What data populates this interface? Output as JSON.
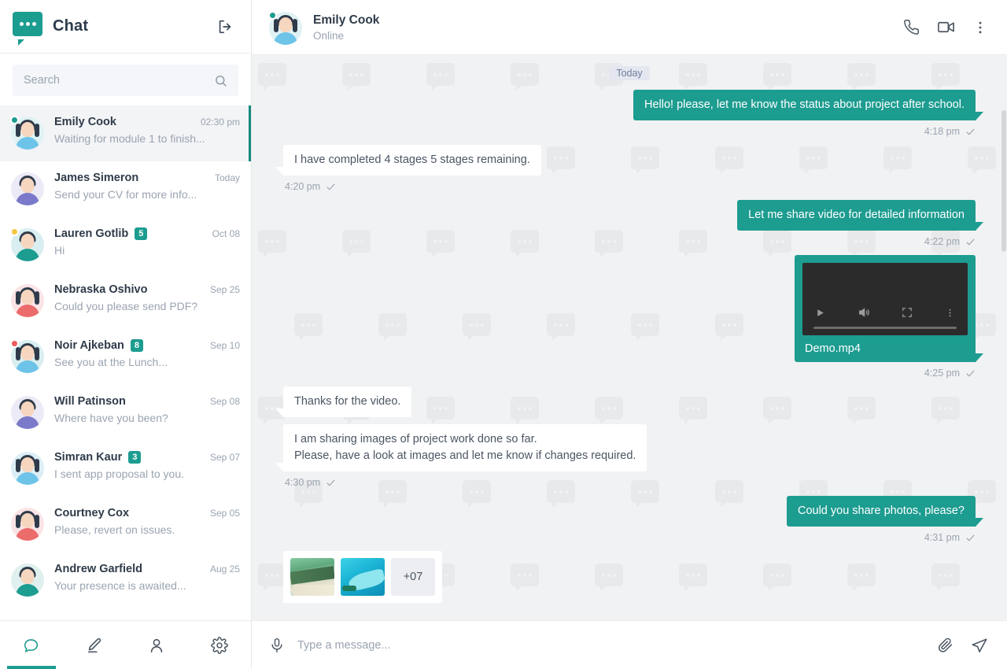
{
  "sidebar": {
    "app_title": "Chat",
    "logo_icon": "chat-bubble-logo",
    "logout_icon": "logout-icon",
    "search": {
      "placeholder": "Search",
      "value": "",
      "icon": "search-icon"
    },
    "contacts": [
      {
        "name": "Emily Cook",
        "preview": "Waiting for module 1 to finish...",
        "time": "02:30 pm",
        "badge": "",
        "status": "online",
        "active": true,
        "avatar": {
          "bg": "#e0f2f4",
          "skin": "#f6d6bf",
          "hair": "#2f3b4a",
          "shirt": "#6ec4e8",
          "dot": "#1d9c90",
          "long_hair": true
        }
      },
      {
        "name": "James Simeron",
        "preview": "Send your CV for more info...",
        "time": "Today",
        "badge": "",
        "status": "none",
        "active": false,
        "avatar": {
          "bg": "#eceaf6",
          "skin": "#f6d6bf",
          "hair": "#2f3b4a",
          "shirt": "#7b79c9",
          "dot": "",
          "long_hair": false
        }
      },
      {
        "name": "Lauren Gotlib",
        "preview": "Hi",
        "time": "Oct 08",
        "badge": "5",
        "status": "away",
        "active": false,
        "avatar": {
          "bg": "#d9eef0",
          "skin": "#f6d6bf",
          "hair": "#2f3b4a",
          "shirt": "#1d9c90",
          "dot": "#f5c544",
          "long_hair": false
        }
      },
      {
        "name": "Nebraska Oshivo",
        "preview": "Could you please send PDF?",
        "time": "Sep 25",
        "badge": "",
        "status": "none",
        "active": false,
        "avatar": {
          "bg": "#fbe3e6",
          "skin": "#f6d6bf",
          "hair": "#2f3b4a",
          "shirt": "#ec6b6b",
          "dot": "",
          "long_hair": true
        }
      },
      {
        "name": "Noir Ajkeban",
        "preview": "See you at the Lunch...",
        "time": "Sep 10",
        "badge": "8",
        "status": "busy",
        "active": false,
        "avatar": {
          "bg": "#d9eef0",
          "skin": "#f6d6bf",
          "hair": "#2f3b4a",
          "shirt": "#6ec4e8",
          "dot": "#ef5b5b",
          "long_hair": true
        }
      },
      {
        "name": "Will Patinson",
        "preview": "Where have you been?",
        "time": "Sep 08",
        "badge": "",
        "status": "none",
        "active": false,
        "avatar": {
          "bg": "#eceaf6",
          "skin": "#f6d6bf",
          "hair": "#2f3b4a",
          "shirt": "#7b79c9",
          "dot": "",
          "long_hair": false
        }
      },
      {
        "name": "Simran Kaur",
        "preview": "I sent app proposal to you.",
        "time": "Sep 07",
        "badge": "3",
        "status": "none",
        "active": false,
        "avatar": {
          "bg": "#ddeff6",
          "skin": "#f6d6bf",
          "hair": "#2f3b4a",
          "shirt": "#6ec4e8",
          "dot": "",
          "long_hair": true
        }
      },
      {
        "name": "Courtney Cox",
        "preview": "Please, revert on issues.",
        "time": "Sep 05",
        "badge": "",
        "status": "none",
        "active": false,
        "avatar": {
          "bg": "#fbe3e6",
          "skin": "#f6d6bf",
          "hair": "#2f3b4a",
          "shirt": "#ec6b6b",
          "dot": "",
          "long_hair": true
        }
      },
      {
        "name": "Andrew Garfield",
        "preview": "Your presence is awaited...",
        "time": "Aug 25",
        "badge": "",
        "status": "none",
        "active": false,
        "avatar": {
          "bg": "#dff0ee",
          "skin": "#f6d6bf",
          "hair": "#2f3b4a",
          "shirt": "#1d9c90",
          "dot": "",
          "long_hair": false
        }
      }
    ],
    "nav": [
      {
        "icon": "chat-icon",
        "label": "Chats",
        "active": true
      },
      {
        "icon": "pencil-icon",
        "label": "Compose",
        "active": false
      },
      {
        "icon": "person-icon",
        "label": "Contacts",
        "active": false
      },
      {
        "icon": "gear-icon",
        "label": "Settings",
        "active": false
      }
    ]
  },
  "chat_header": {
    "name": "Emily Cook",
    "status": "Online",
    "actions": [
      {
        "icon": "phone-icon",
        "label": "Voice call"
      },
      {
        "icon": "video-camera-icon",
        "label": "Video call"
      },
      {
        "icon": "more-vertical-icon",
        "label": "More options"
      }
    ]
  },
  "conversation": {
    "day_divider": "Today",
    "messages": [
      {
        "type": "text",
        "dir": "out",
        "text": "Hello! please, let me know the status about project after school.",
        "time": "4:18 pm",
        "tick": true
      },
      {
        "type": "text",
        "dir": "in",
        "text": "I have completed 4 stages 5 stages remaining.",
        "time": "4:20 pm",
        "tick": true
      },
      {
        "type": "text",
        "dir": "out",
        "text": "Let me share video for detailed information",
        "time": "4:22 pm",
        "tick": true
      },
      {
        "type": "video",
        "dir": "out",
        "filename": "Demo.mp4",
        "time": "4:25 pm",
        "tick": true,
        "controls": [
          {
            "icon": "play-icon"
          },
          {
            "icon": "volume-icon"
          },
          {
            "icon": "fullscreen-icon"
          },
          {
            "icon": "more-vertical-icon"
          }
        ]
      },
      {
        "type": "text",
        "dir": "in",
        "text": "Thanks for the video.",
        "time": "",
        "tick": false
      },
      {
        "type": "text",
        "dir": "in",
        "line1": "I am sharing images of project work done so far.",
        "line2": "Please, have a look at images and let me know if changes required.",
        "time": "4:30 pm",
        "tick": true
      },
      {
        "type": "text",
        "dir": "out",
        "text": "Could you share photos, please?",
        "time": "4:31 pm",
        "tick": true
      },
      {
        "type": "images",
        "dir": "in",
        "more_label": "+07",
        "time": "",
        "tick": false
      }
    ]
  },
  "composer": {
    "mic_icon": "microphone-icon",
    "placeholder": "Type a message...",
    "value": "",
    "attach_icon": "paperclip-icon",
    "send_icon": "send-icon"
  },
  "colors": {
    "accent": "#1d9c90",
    "accent_dark": "#14897f",
    "bubble_in": "#ffffff",
    "chat_bg": "#f1f2f3",
    "text_dark": "#2f3b4a",
    "text_muted": "#9aa4b1",
    "badge_unread": "#1d9c90",
    "status_online": "#1d9c90",
    "status_away": "#f5c544",
    "status_busy": "#ef5b5b"
  }
}
